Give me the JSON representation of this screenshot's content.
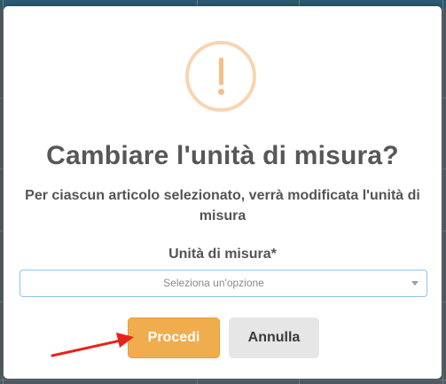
{
  "dialog": {
    "title": "Cambiare l'unità di misura?",
    "message": "Per ciascun articolo selezionato, verrà modificata l'unità di misura",
    "field_label": "Unità di misura*",
    "select_placeholder": "Seleziona un'opzione",
    "confirm_label": "Procedi",
    "cancel_label": "Annulla",
    "icon": "warning-icon"
  },
  "colors": {
    "confirm_button": "#f0ad4e",
    "cancel_button": "#e6e6e6",
    "warning_icon": "#f6be8a",
    "annotation_arrow": "#e8231a",
    "select_border": "#8fc4ea"
  },
  "annotation": {
    "type": "arrow",
    "points_to": "confirm-button"
  }
}
